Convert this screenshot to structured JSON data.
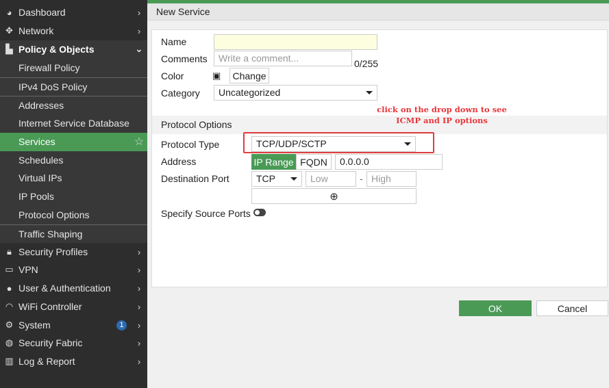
{
  "sidebar": {
    "items": [
      {
        "label": "Dashboard",
        "icon": "dashboard-icon"
      },
      {
        "label": "Network",
        "icon": "network-icon"
      },
      {
        "label": "Policy & Objects",
        "icon": "policy-icon"
      },
      {
        "label": "Firewall Policy"
      },
      {
        "label": "IPv4 DoS Policy"
      },
      {
        "label": "Addresses"
      },
      {
        "label": "Internet Service Database"
      },
      {
        "label": "Services"
      },
      {
        "label": "Schedules"
      },
      {
        "label": "Virtual IPs"
      },
      {
        "label": "IP Pools"
      },
      {
        "label": "Protocol Options"
      },
      {
        "label": "Traffic Shaping"
      },
      {
        "label": "Security Profiles",
        "icon": "lock-icon"
      },
      {
        "label": "VPN",
        "icon": "laptop-icon"
      },
      {
        "label": "User & Authentication",
        "icon": "user-icon"
      },
      {
        "label": "WiFi Controller",
        "icon": "wifi-icon"
      },
      {
        "label": "System",
        "icon": "gear-icon",
        "badge": "1"
      },
      {
        "label": "Security Fabric",
        "icon": "fabric-icon"
      },
      {
        "label": "Log & Report",
        "icon": "chart-icon"
      }
    ]
  },
  "header": {
    "title": "New Service"
  },
  "form": {
    "name_label": "Name",
    "name_value": "",
    "comments_label": "Comments",
    "comments_placeholder": "Write a comment...",
    "comments_count": "0/255",
    "color_label": "Color",
    "color_change": "Change",
    "category_label": "Category",
    "category_value": "Uncategorized",
    "protocol_options_title": "Protocol Options",
    "protocol_type_label": "Protocol Type",
    "protocol_type_value": "TCP/UDP/SCTP",
    "address_label": "Address",
    "address_ip_range": "IP Range",
    "address_fqdn": "FQDN",
    "address_value": "0.0.0.0",
    "dest_port_label": "Destination Port",
    "dest_port_proto": "TCP",
    "dest_port_low": "Low",
    "dest_port_sep": "-",
    "dest_port_high": "High",
    "source_ports_label": "Specify Source Ports"
  },
  "annotation": {
    "line1": "click on the drop down to see",
    "line2": "ICMP and  IP options"
  },
  "buttons": {
    "ok": "OK",
    "cancel": "Cancel"
  },
  "colors": {
    "accent": "#4a9a56",
    "annotation": "#e03c40"
  }
}
